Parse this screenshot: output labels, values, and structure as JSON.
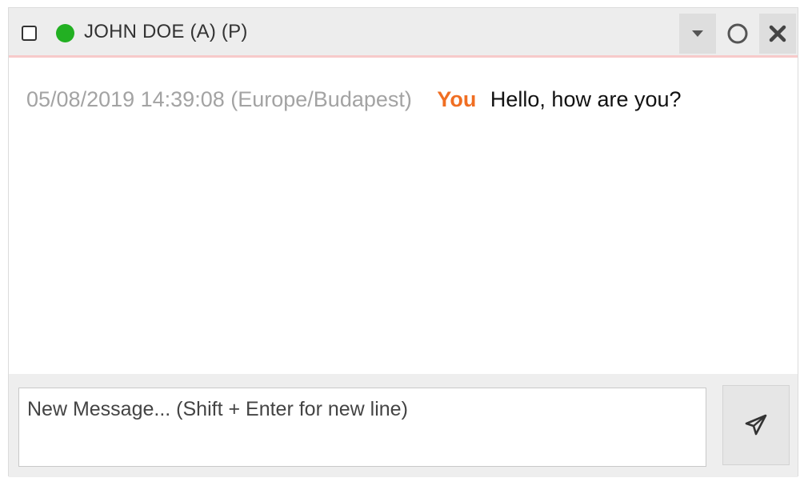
{
  "header": {
    "title": "JOHN DOE (A) (P)",
    "status_color": "#22b022",
    "divider_color": "#f7caca",
    "buttons": [
      {
        "icon": "caret-down-icon"
      },
      {
        "icon": "circle-icon"
      },
      {
        "icon": "close-icon"
      }
    ]
  },
  "messages": [
    {
      "timestamp": "05/08/2019 14:39:08 (Europe/Budapest)",
      "sender": "You",
      "text": "Hello, how are you?"
    }
  ],
  "composer": {
    "placeholder": "New Message... (Shift + Enter for new line)",
    "value": "",
    "send_icon": "paper-plane-icon"
  },
  "colors": {
    "sender": "#f06e22",
    "timestamp": "#a3a3a3"
  }
}
